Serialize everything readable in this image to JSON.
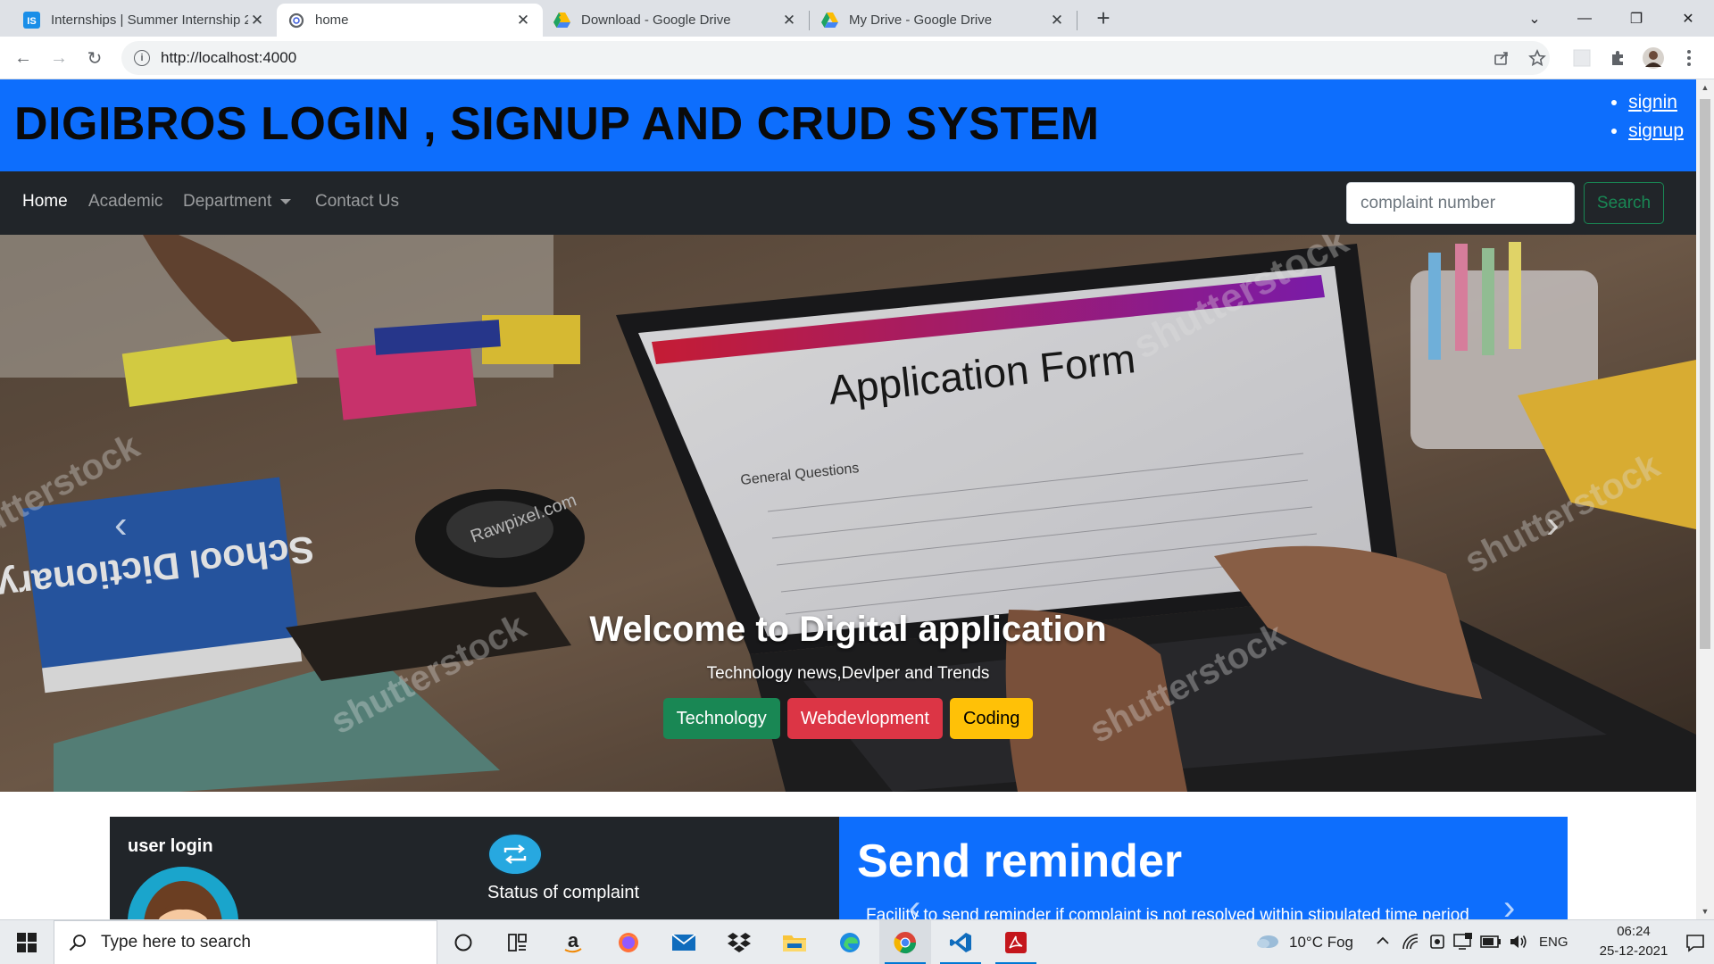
{
  "browser": {
    "tabs": [
      {
        "title": "Internships | Summer Internship 2",
        "favicon": "internshala-icon",
        "active": false
      },
      {
        "title": "home",
        "favicon": "page-icon",
        "active": true
      },
      {
        "title": "Download - Google Drive",
        "favicon": "google-drive-icon",
        "active": false
      },
      {
        "title": "My Drive - Google Drive",
        "favicon": "google-drive-icon",
        "active": false
      }
    ],
    "tab_close_glyph": "✕",
    "new_tab_glyph": "+",
    "internshala_badge": "IS",
    "url": "http://localhost:4000",
    "window_controls": {
      "chevron": "⌄",
      "minimize": "—",
      "restore": "❐",
      "close": "✕"
    },
    "nav_glyphs": {
      "back": "←",
      "forward": "→",
      "reload": "↻",
      "info": "i"
    }
  },
  "page": {
    "title": "DIGIBROS LOGIN , SIGNUP AND CRUD SYSTEM",
    "auth_links": [
      "signin",
      "signup"
    ],
    "nav": {
      "home": "Home",
      "academic": "Academic",
      "department": "Department",
      "contact": "Contact Us",
      "search_placeholder": "complaint number",
      "search_button": "Search"
    },
    "carousel": {
      "title": "Welcome to Digital application",
      "subtitle": "Technology news,Devlper and Trends",
      "buttons": [
        "Technology",
        "Webdevlopment",
        "Coding"
      ],
      "prev_glyph": "‹",
      "next_glyph": "›",
      "image_text": {
        "form_title": "Application Form",
        "section": "General Questions",
        "book": "School Dictionary",
        "stamp": "Rawpixel.com",
        "watermark": "shutterstock"
      }
    },
    "cards": {
      "user_login": "user login",
      "status": "Status of complaint",
      "reminder_title": "Send reminder",
      "reminder_desc": "Facility to send reminder if complaint is not resolved within stipulated time period"
    }
  },
  "taskbar": {
    "search_placeholder": "Type here to search",
    "weather": "10°C  Fog",
    "language": "ENG",
    "time": "06:24",
    "date": "25-12-2021",
    "amazon_glyph": "a"
  },
  "colors": {
    "primary": "#0d6efd",
    "dark": "#212529",
    "success": "#198754",
    "danger": "#dc3545",
    "warning": "#ffc107"
  }
}
